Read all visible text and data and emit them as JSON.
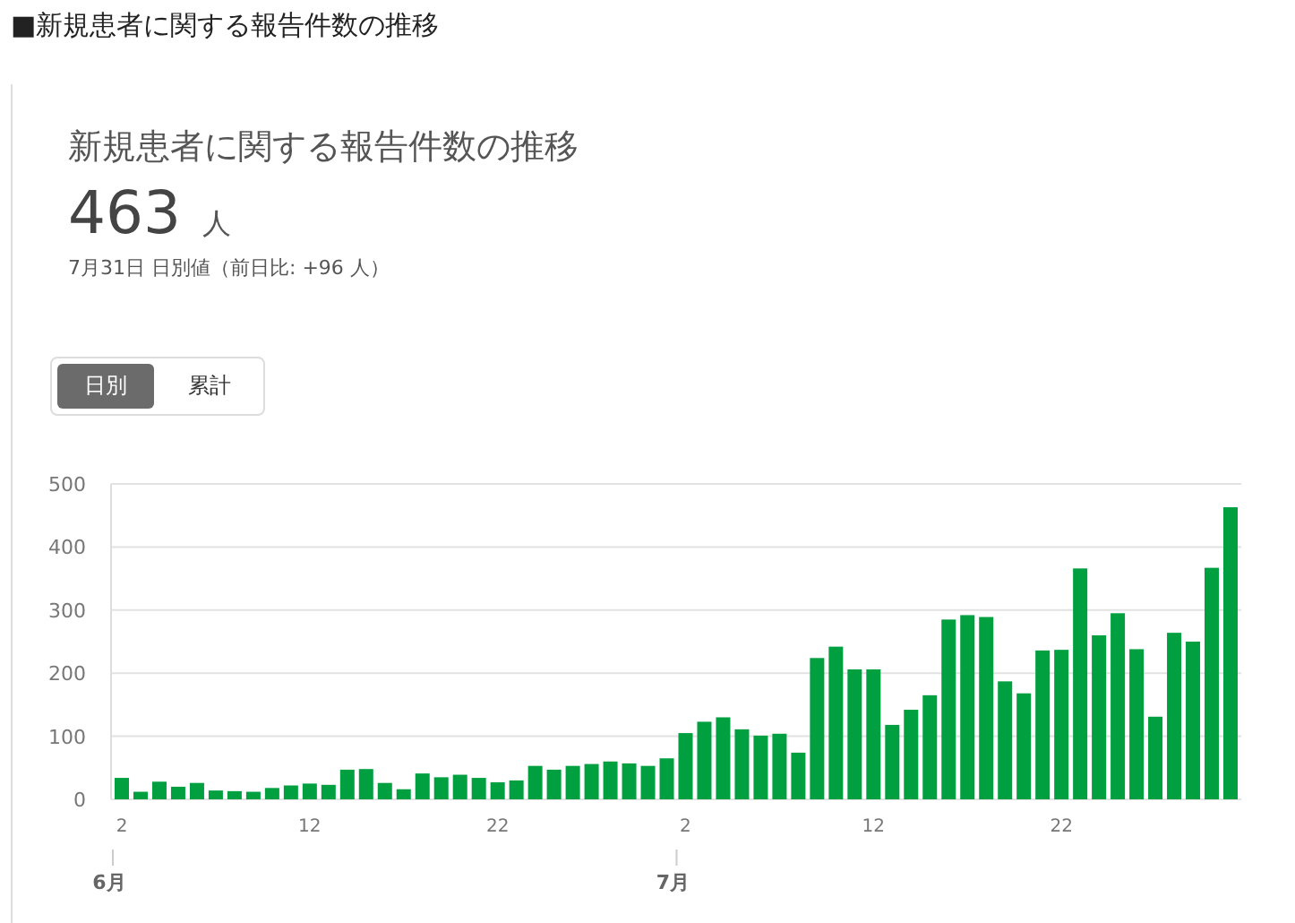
{
  "heading": "■新規患者に関する報告件数の推移",
  "card": {
    "title": "新規患者に関する報告件数の推移",
    "value": "463",
    "unit": "人",
    "note": "7月31日 日別値（前日比: +96 人）",
    "toggle": [
      {
        "label": "日別",
        "selected": true
      },
      {
        "label": "累計",
        "selected": false
      }
    ],
    "chart_data": {
      "type": "bar",
      "grid": true,
      "ylim": [
        0,
        500
      ],
      "yticks": [
        0,
        100,
        200,
        300,
        400,
        500
      ],
      "annotations": [
        "6月",
        "7月"
      ],
      "categories": [
        "2",
        null,
        null,
        null,
        null,
        null,
        null,
        null,
        null,
        null,
        "12",
        null,
        null,
        null,
        null,
        null,
        null,
        null,
        null,
        null,
        "22",
        null,
        null,
        null,
        null,
        null,
        null,
        null,
        null,
        null,
        "2",
        null,
        null,
        null,
        null,
        null,
        null,
        null,
        null,
        null,
        "12",
        null,
        null,
        null,
        null,
        null,
        null,
        null,
        null,
        null,
        "22",
        null,
        null,
        null,
        null,
        null,
        null,
        null,
        null,
        null
      ],
      "series": [
        {
          "color": "#00a040",
          "values": [
            34,
            12,
            28,
            20,
            26,
            14,
            13,
            12,
            18,
            22,
            25,
            23,
            47,
            48,
            26,
            16,
            41,
            35,
            39,
            34,
            27,
            30,
            53,
            47,
            53,
            56,
            60,
            57,
            53,
            65,
            105,
            123,
            130,
            111,
            101,
            104,
            74,
            224,
            242,
            206,
            206,
            118,
            142,
            165,
            285,
            292,
            289,
            187,
            168,
            236,
            237,
            366,
            260,
            295,
            238,
            131,
            264,
            250,
            367,
            463
          ]
        }
      ]
    }
  }
}
